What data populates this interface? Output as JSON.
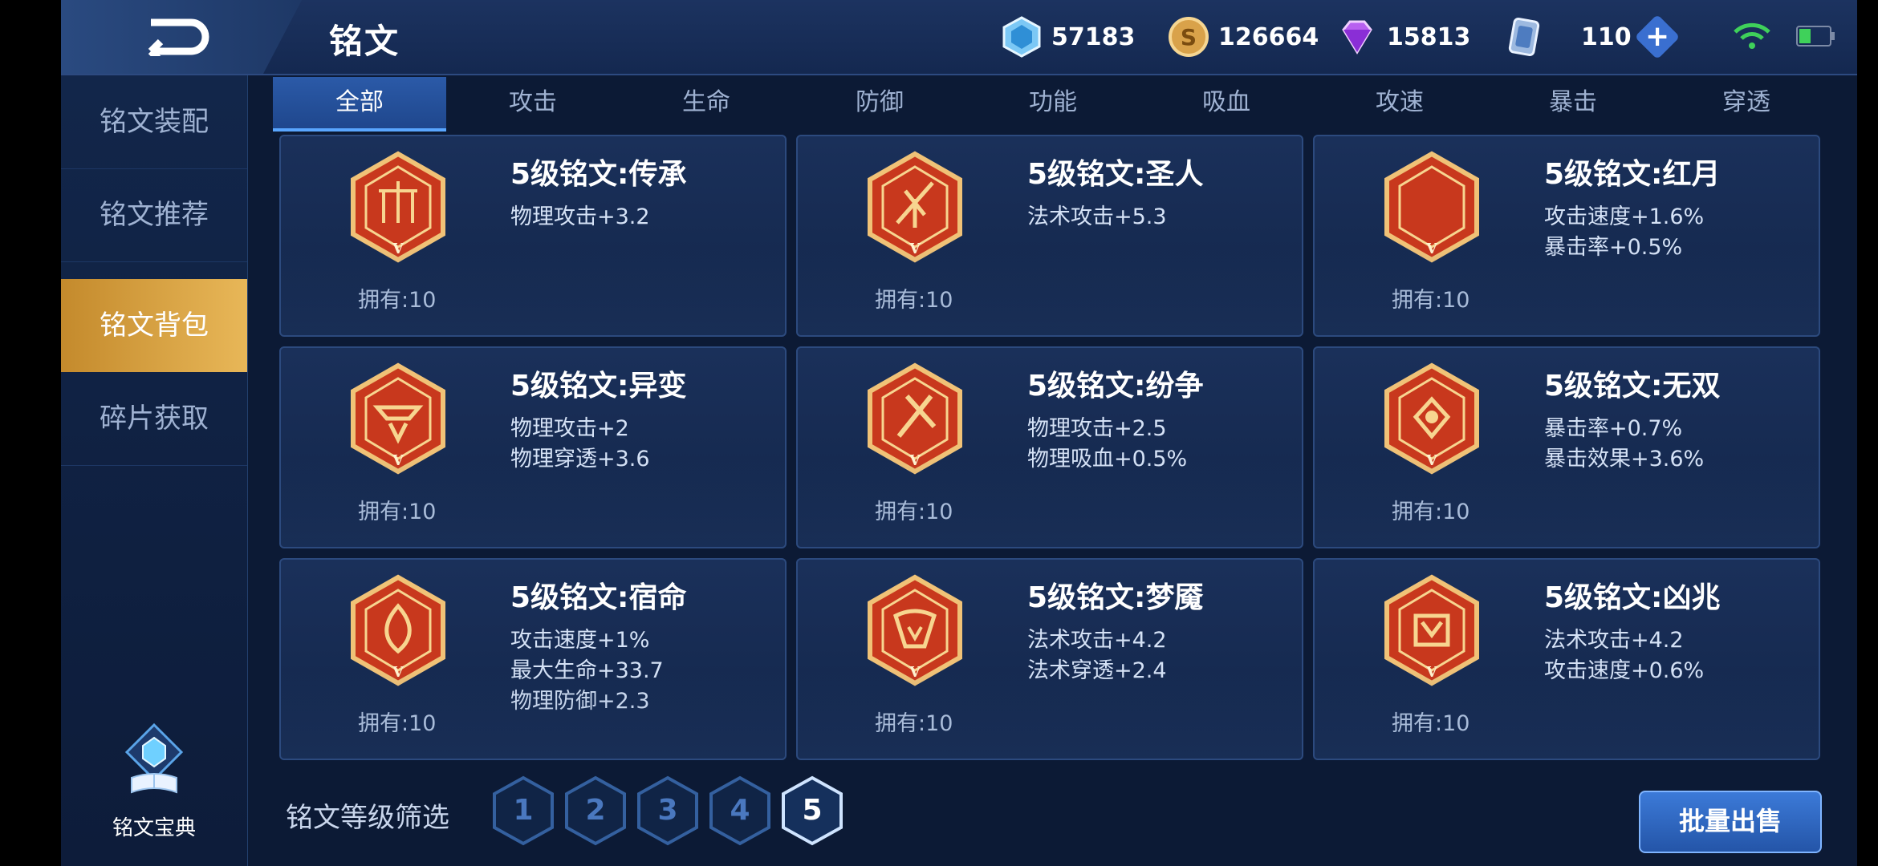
{
  "header": {
    "title": "铭文"
  },
  "currencies": [
    {
      "name": "diamond",
      "icon": "blue-crystal-icon",
      "value": "57183"
    },
    {
      "name": "gold",
      "icon": "gold-coin-icon",
      "value": "126664"
    },
    {
      "name": "gem",
      "icon": "purple-gem-icon",
      "value": "15813"
    },
    {
      "name": "card",
      "icon": "card-icon",
      "value": "110"
    }
  ],
  "sidebar": {
    "items": [
      {
        "label": "铭文装配"
      },
      {
        "label": "铭文推荐"
      },
      {
        "label": "铭文背包",
        "active": true
      },
      {
        "label": "碎片获取"
      }
    ],
    "codex_label": "铭文宝典"
  },
  "tabs": [
    {
      "label": "全部",
      "active": true
    },
    {
      "label": "攻击"
    },
    {
      "label": "生命"
    },
    {
      "label": "防御"
    },
    {
      "label": "功能"
    },
    {
      "label": "吸血"
    },
    {
      "label": "攻速"
    },
    {
      "label": "暴击"
    },
    {
      "label": "穿透"
    }
  ],
  "cards": [
    {
      "title": "5级铭文:传承",
      "stats": [
        "物理攻击+3.2"
      ],
      "owned": "拥有:10"
    },
    {
      "title": "5级铭文:圣人",
      "stats": [
        "法术攻击+5.3"
      ],
      "owned": "拥有:10"
    },
    {
      "title": "5级铭文:红月",
      "stats": [
        "攻击速度+1.6%",
        "暴击率+0.5%"
      ],
      "owned": "拥有:10"
    },
    {
      "title": "5级铭文:异变",
      "stats": [
        "物理攻击+2",
        "物理穿透+3.6"
      ],
      "owned": "拥有:10"
    },
    {
      "title": "5级铭文:纷争",
      "stats": [
        "物理攻击+2.5",
        "物理吸血+0.5%"
      ],
      "owned": "拥有:10"
    },
    {
      "title": "5级铭文:无双",
      "stats": [
        "暴击率+0.7%",
        "暴击效果+3.6%"
      ],
      "owned": "拥有:10"
    },
    {
      "title": "5级铭文:宿命",
      "stats": [
        "攻击速度+1%",
        "最大生命+33.7",
        "物理防御+2.3"
      ],
      "owned": "拥有:10"
    },
    {
      "title": "5级铭文:梦魇",
      "stats": [
        "法术攻击+4.2",
        "法术穿透+2.4"
      ],
      "owned": "拥有:10"
    },
    {
      "title": "5级铭文:凶兆",
      "stats": [
        "法术攻击+4.2",
        "攻击速度+0.6%"
      ],
      "owned": "拥有:10"
    }
  ],
  "badge_roman": "V",
  "filter": {
    "label": "铭文等级筛选",
    "levels": [
      "1",
      "2",
      "3",
      "4",
      "5"
    ],
    "active_level": "5"
  },
  "sell_button": "批量出售",
  "colors": {
    "accent_gold": "#e8b758",
    "accent_blue": "#3c7ad8",
    "badge_red": "#c8381d"
  }
}
